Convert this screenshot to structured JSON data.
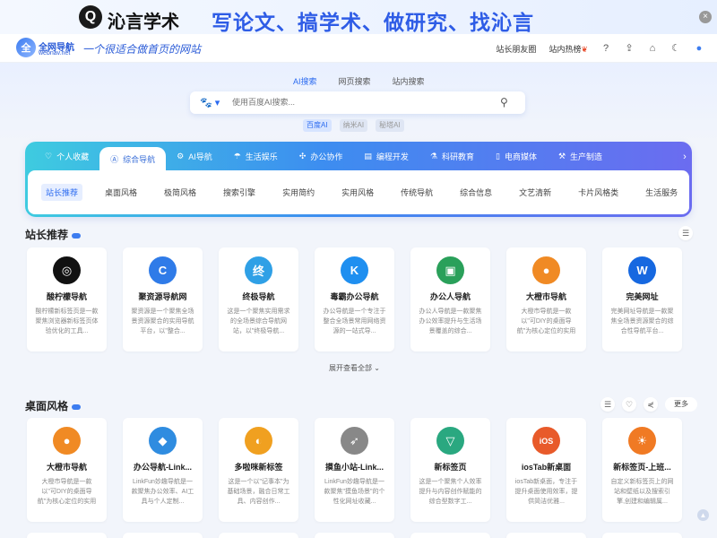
{
  "banner": {
    "logo_char": "Q",
    "brand": "沁言学术",
    "slogan": "写论文、搞学术、做研究、找沁言",
    "close": "×"
  },
  "header": {
    "logo_char": "全",
    "site_name": "全网导航",
    "site_url": "webnav.net",
    "site_slogan": "一个很适合做首页的网站",
    "links": [
      "站长朋友圈",
      "站内热榜"
    ]
  },
  "search": {
    "tabs": [
      "AI搜索",
      "网页搜索",
      "站内搜索"
    ],
    "engine_icon": "🐾",
    "placeholder": "使用百度AI搜索...",
    "chips": [
      "百度AI",
      "纳米AI",
      "秘塔AI"
    ]
  },
  "nav": {
    "tabs": [
      {
        "icon": "♡",
        "label": "个人收藏"
      },
      {
        "icon": "Ⓐ",
        "label": "综合导航"
      },
      {
        "icon": "⚙",
        "label": "AI导航"
      },
      {
        "icon": "☂",
        "label": "生活娱乐"
      },
      {
        "icon": "✣",
        "label": "办公协作"
      },
      {
        "icon": "▤",
        "label": "编程开发"
      },
      {
        "icon": "⚗",
        "label": "科研教育"
      },
      {
        "icon": "▯",
        "label": "电商媒体"
      },
      {
        "icon": "⚒",
        "label": "生产制造"
      }
    ],
    "sub": [
      "站长推荐",
      "桌面风格",
      "极简风格",
      "搜索引擎",
      "实用简约",
      "实用风格",
      "传统导航",
      "综合信息",
      "文艺清新",
      "卡片风格类",
      "生活服务"
    ]
  },
  "section1": {
    "title": "站长推荐",
    "expand": "展开查看全部",
    "cards": [
      {
        "icon": "◎",
        "color": "#111111",
        "name": "酸柠檬导航",
        "desc": "酸柠檬新标签页是一款聚焦浏览器新标签页体验优化的工具..."
      },
      {
        "icon": "C",
        "color": "#2f7be8",
        "name": "聚资源导航网",
        "desc": "聚资源是一个聚焦全场景资源聚合的实用导航平台，以\"整合..."
      },
      {
        "icon": "终",
        "color": "#2fa0e6",
        "name": "终极导航",
        "desc": "这是一个聚焦实用需求的全场景综合导航网站，以\"终极导航..."
      },
      {
        "icon": "K",
        "color": "#1f8ff0",
        "name": "毒霸办公导航",
        "desc": "办公导航是一个专注于整合全场景常用网络资源的一站式导..."
      },
      {
        "icon": "▣",
        "color": "#2aa05a",
        "name": "办公人导航",
        "desc": "办公人导航是一款聚焦办公效率提升与生活场景覆盖的综合..."
      },
      {
        "icon": "●",
        "color": "#f08a24",
        "name": "大橙市导航",
        "desc": "大橙市导航是一款以\"可DIY的桌面导航\"为核心定位的实用型..."
      },
      {
        "icon": "W",
        "color": "#1668e0",
        "name": "完美网址",
        "desc": "完美网址导航是一款聚焦全场景资源聚合的综合性导航平台..."
      }
    ]
  },
  "section2": {
    "title": "桌面风格",
    "more": "更多",
    "cards": [
      {
        "icon": "●",
        "color": "#f08a24",
        "name": "大橙市导航",
        "desc": "大橙市导航是一款以\"可DIY的桌面导航\"为核心定位的实用型..."
      },
      {
        "icon": "◆",
        "color": "#2f8ce0",
        "name": "办公导航-Link...",
        "desc": "LinkFun妙趣导航是一款聚焦办公效率、AI工具与个人定制..."
      },
      {
        "icon": "◐",
        "color": "#f0a020",
        "name": "多啦咪新标签",
        "desc": "这是一个以\"记事本\"为基础场景，融合日常工具、内容创作..."
      },
      {
        "icon": "➶",
        "color": "#888888",
        "name": "摸鱼小站-Link...",
        "desc": "LinkFun妙趣导航是一款聚焦\"摸鱼场景\"的个性化网址收藏..."
      },
      {
        "icon": "▽",
        "color": "#2aa880",
        "name": "新标签页",
        "desc": "这是一个聚焦个人效率提升与内容创作赋能的综合型数字工..."
      },
      {
        "icon": "iOS",
        "color": "#e85a2a",
        "name": "iosTab新桌面",
        "desc": "iosTab新桌面，专注于提升桌面使用效率，提供简洁优雅..."
      },
      {
        "icon": "☀",
        "color": "#f07a24",
        "name": "新标签页-上班...",
        "desc": "自定义新标签页上的网站和壁纸以及搜索引擎,创建和编辑属..."
      }
    ]
  }
}
